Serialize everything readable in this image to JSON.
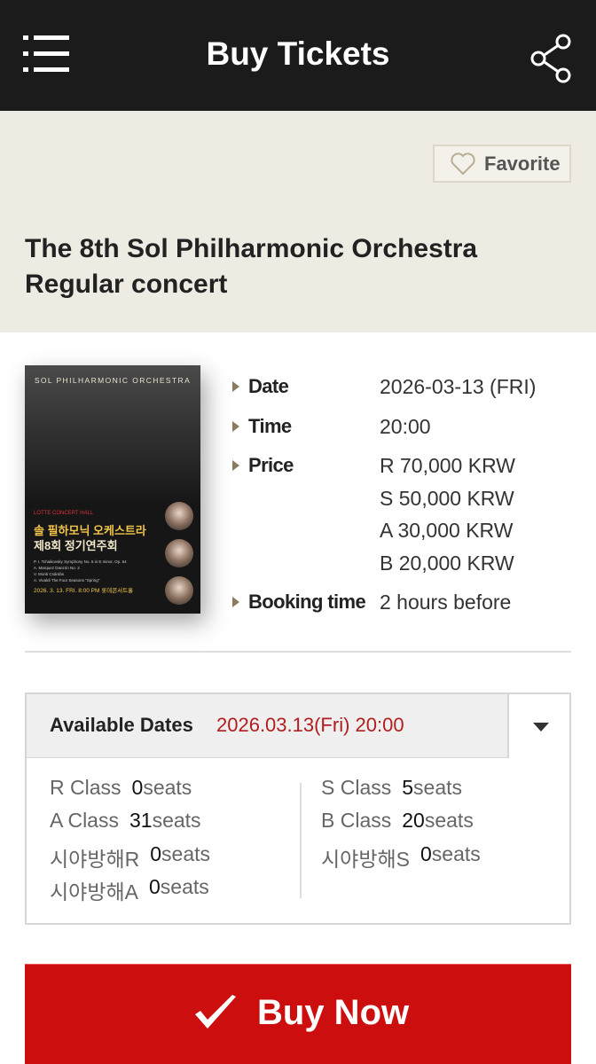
{
  "header": {
    "title": "Buy Tickets",
    "menu_icon": "hamburger-menu-icon",
    "share_icon": "share-icon"
  },
  "hero": {
    "favorite_label": "Favorite",
    "title": "The 8th Sol Philharmonic Orchestra Regular concert"
  },
  "poster": {
    "orchestra": "SOL PHILHARMONIC ORCHESTRA",
    "venue": "LOTTE CONCERT HALL",
    "title_kr_1": "솔 필하모닉 오케스트라",
    "title_kr_2": "제8회 정기연주회",
    "program_1": "P. I. Tchaikovsky Symphony No. 5 in E minor, Op. 64",
    "program_2": "A. Marquez Danzón No. 2",
    "program_3": "V. Monti Csárdás",
    "program_4": "A. Vivaldi The Four Seasons \"Spring\"",
    "date": "2026. 3. 13. FRI. 8:00 PM 롯데콘서트홀"
  },
  "info": {
    "date_label": "Date",
    "date_value": "2026-03-13 (FRI)",
    "time_label": "Time",
    "time_value": "20:00",
    "price_label": "Price",
    "prices": [
      "R 70,000 KRW",
      "S 50,000 KRW",
      "A 30,000 KRW",
      "B 20,000 KRW"
    ],
    "booking_label": "Booking time",
    "booking_value": "2 hours before"
  },
  "availability": {
    "label": "Available Dates",
    "selected": "2026.03.13(Fri) 20:00",
    "left": [
      {
        "cls": "R Class",
        "num": "0",
        "unit": "seats"
      },
      {
        "cls": "A Class",
        "num": "31",
        "unit": "seats"
      },
      {
        "cls": "시야방해R",
        "num": "0",
        "unit": "seats"
      },
      {
        "cls": "시야방해A",
        "num": "0",
        "unit": "seats"
      }
    ],
    "right": [
      {
        "cls": "S Class",
        "num": "5",
        "unit": "seats"
      },
      {
        "cls": "B Class",
        "num": "20",
        "unit": "seats"
      },
      {
        "cls": "시야방해S",
        "num": "0",
        "unit": "seats"
      }
    ]
  },
  "buy": {
    "label": "Buy Now"
  },
  "colors": {
    "header_bg": "#1b1b1b",
    "hero_bg": "#eeebe3",
    "accent_red": "#cc0e0e",
    "date_red": "#b21e1e"
  }
}
